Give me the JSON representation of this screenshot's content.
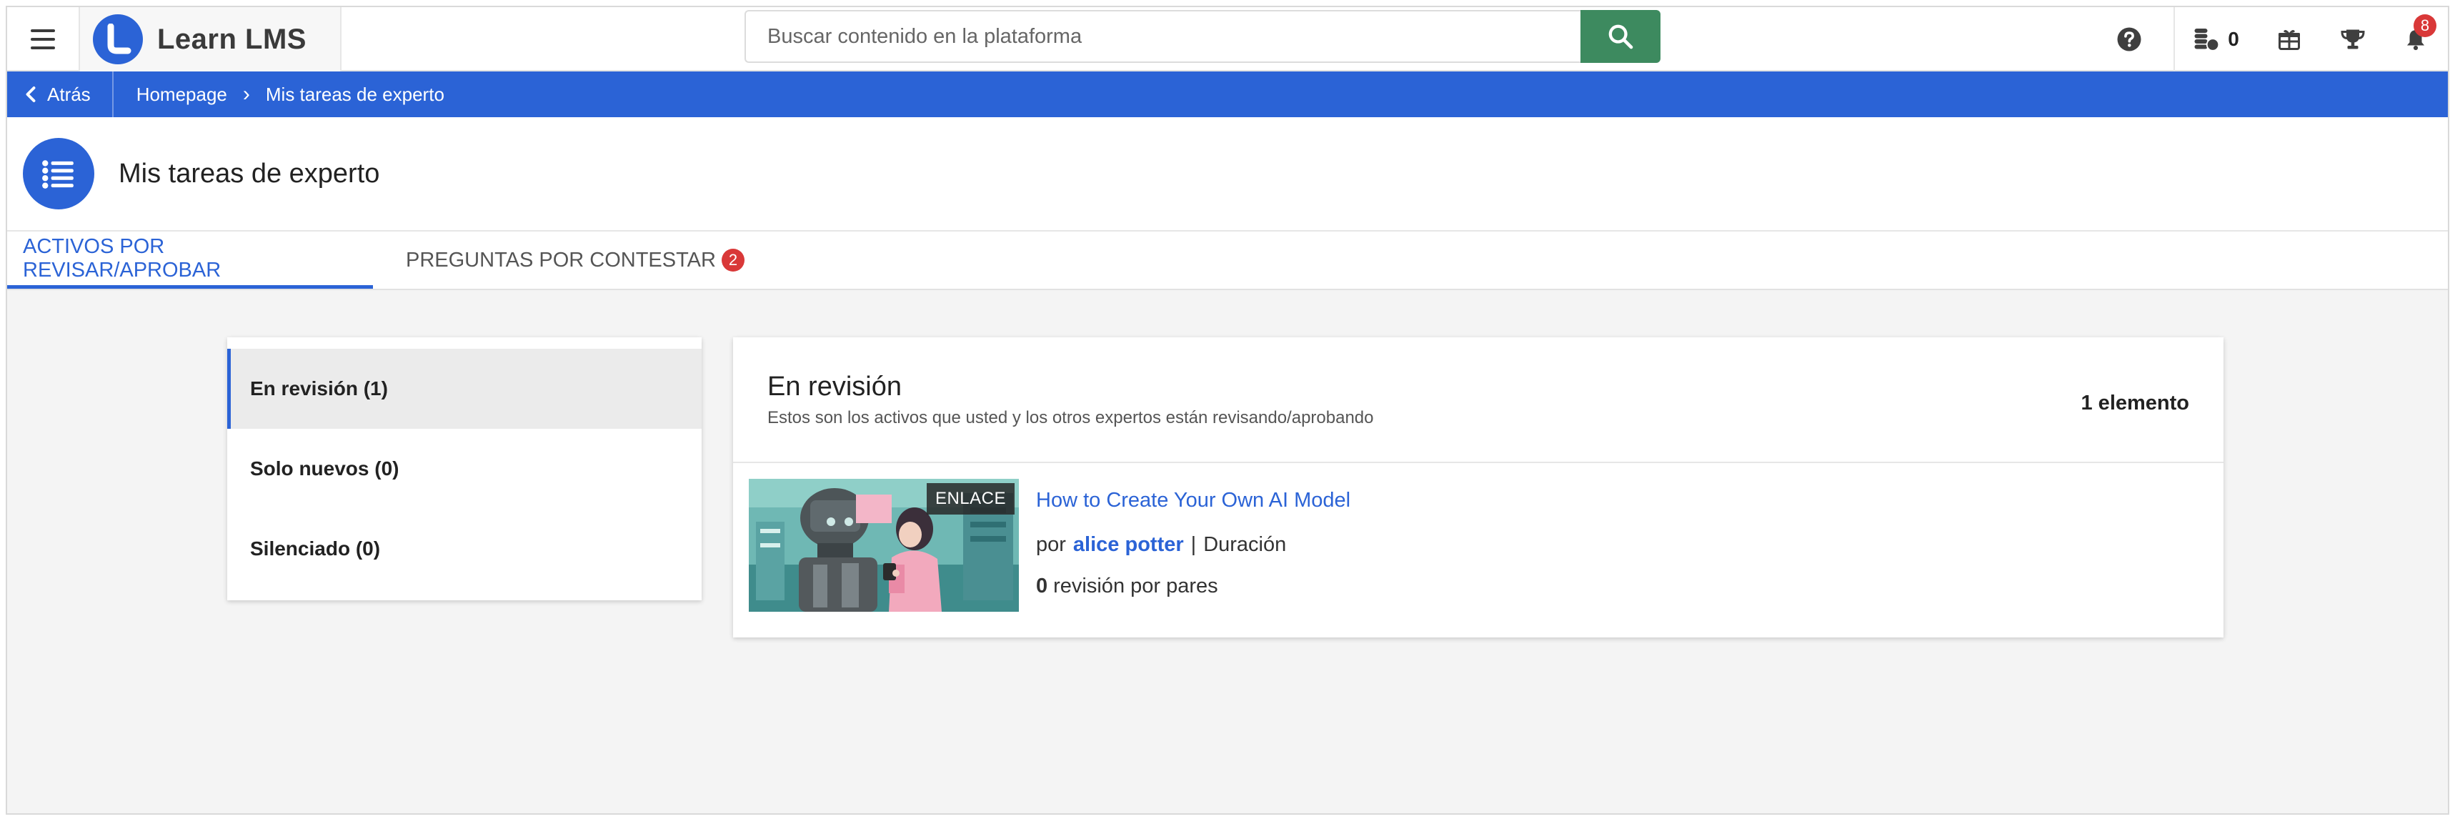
{
  "header": {
    "brand_name": "Learn LMS",
    "search_placeholder": "Buscar contenido en la plataforma",
    "coins_count": "0",
    "notifications_count": "8",
    "icons": [
      "menu-icon",
      "search-icon",
      "help-icon",
      "coins-icon",
      "gift-icon",
      "trophy-icon",
      "bell-icon"
    ]
  },
  "breadcrumb": {
    "back_label": "Atrás",
    "items": [
      "Homepage",
      "Mis tareas de experto"
    ],
    "separator": "›"
  },
  "page": {
    "title": "Mis tareas de experto"
  },
  "tabs": [
    {
      "label": "ACTIVOS POR REVISAR/APROBAR",
      "active": true
    },
    {
      "label": "PREGUNTAS POR CONTESTAR",
      "badge": "2",
      "active": false
    }
  ],
  "filters": [
    {
      "label": "En revisión (1)",
      "active": true
    },
    {
      "label": "Solo nuevos (0)",
      "active": false
    },
    {
      "label": "Silenciado (0)",
      "active": false
    }
  ],
  "review": {
    "title": "En revisión",
    "subtitle": "Estos son los activos que usted y los otros expertos están revisando/aprobando",
    "count_label": "1 elemento",
    "asset": {
      "tag": "ENLACE",
      "title": "How to Create Your Own AI Model",
      "by_label": "por",
      "author": "alice potter",
      "separator": "|",
      "duration_label": "Duración",
      "reviews_count": "0",
      "reviews_label": "revisión por pares"
    }
  },
  "colors": {
    "primary": "#2b63d6",
    "search_button": "#3d8a5f",
    "badge": "#d93838",
    "background": "#f4f4f4"
  }
}
